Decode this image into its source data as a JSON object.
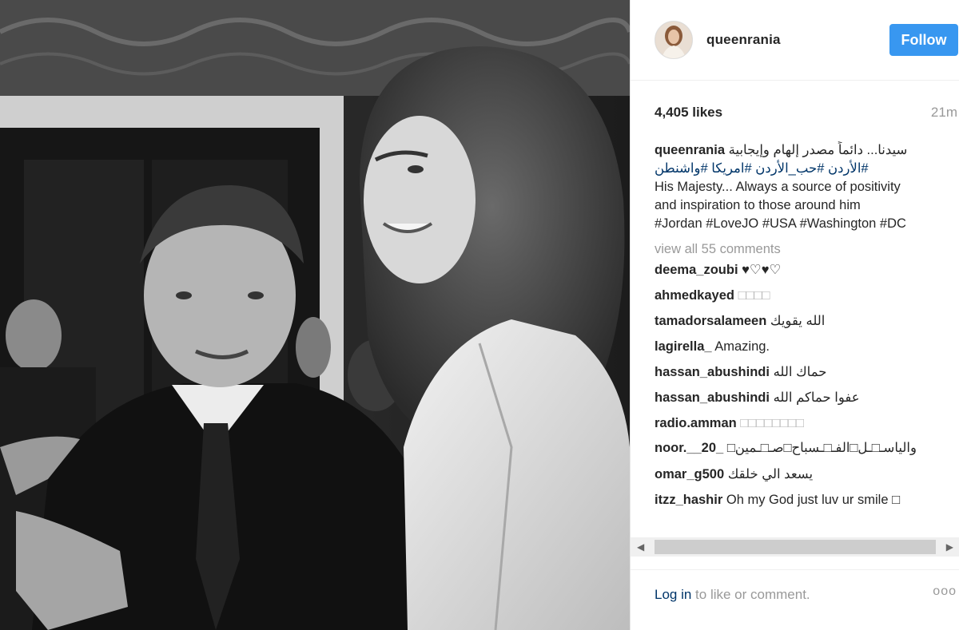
{
  "post": {
    "username": "queenrania",
    "follow_label": "Follow",
    "likes": "4,405 likes",
    "time": "21m",
    "caption_user": "queenrania",
    "caption_ar_1": "سيدنا... دائماً مصدر إلهام وإيجابية",
    "caption_ar_2": "#الأردن #حب_الأردن #امريكا #واشنطن",
    "caption_en_1": "His Majesty... Always a source of positivity",
    "caption_en_2": "and inspiration to those around him",
    "caption_tags": "#Jordan #LoveJO #USA #Washington #DC",
    "view_all": "view all 55 comments",
    "login_link": "Log in",
    "login_rest": " to like or comment.",
    "more_icon": "ooo"
  },
  "comments": [
    {
      "user": "deema_zoubi",
      "text": "♥♡♥♡"
    },
    {
      "user": "ahmedkayed",
      "text": "□□□□"
    },
    {
      "user": "tamadorsalameen",
      "text": "الله يقويك"
    },
    {
      "user": "lagirella_",
      "text": "Amazing."
    },
    {
      "user": "hassan_abushindi",
      "text": "حماك الله"
    },
    {
      "user": "hassan_abushindi",
      "text": "عفوا حماكم الله"
    },
    {
      "user": "radio.amman",
      "text": "□□□□□□□□"
    },
    {
      "user": "noor.__20_",
      "text": "والياسـ□ـل□الفـ□ـسباح□صـ□ـمين□"
    },
    {
      "user": "omar_g500",
      "text": "يسعد الي خلقك"
    },
    {
      "user": "itzz_hashir",
      "text": "Oh my God just luv ur smile □"
    }
  ],
  "colors": {
    "follow_bg": "#3897f0",
    "link": "#003569",
    "muted": "#999999",
    "text": "#262626"
  },
  "icons": {
    "scroll_left": "scroll-left-arrow-icon",
    "scroll_right": "scroll-right-arrow-icon",
    "more": "more-options-icon"
  }
}
